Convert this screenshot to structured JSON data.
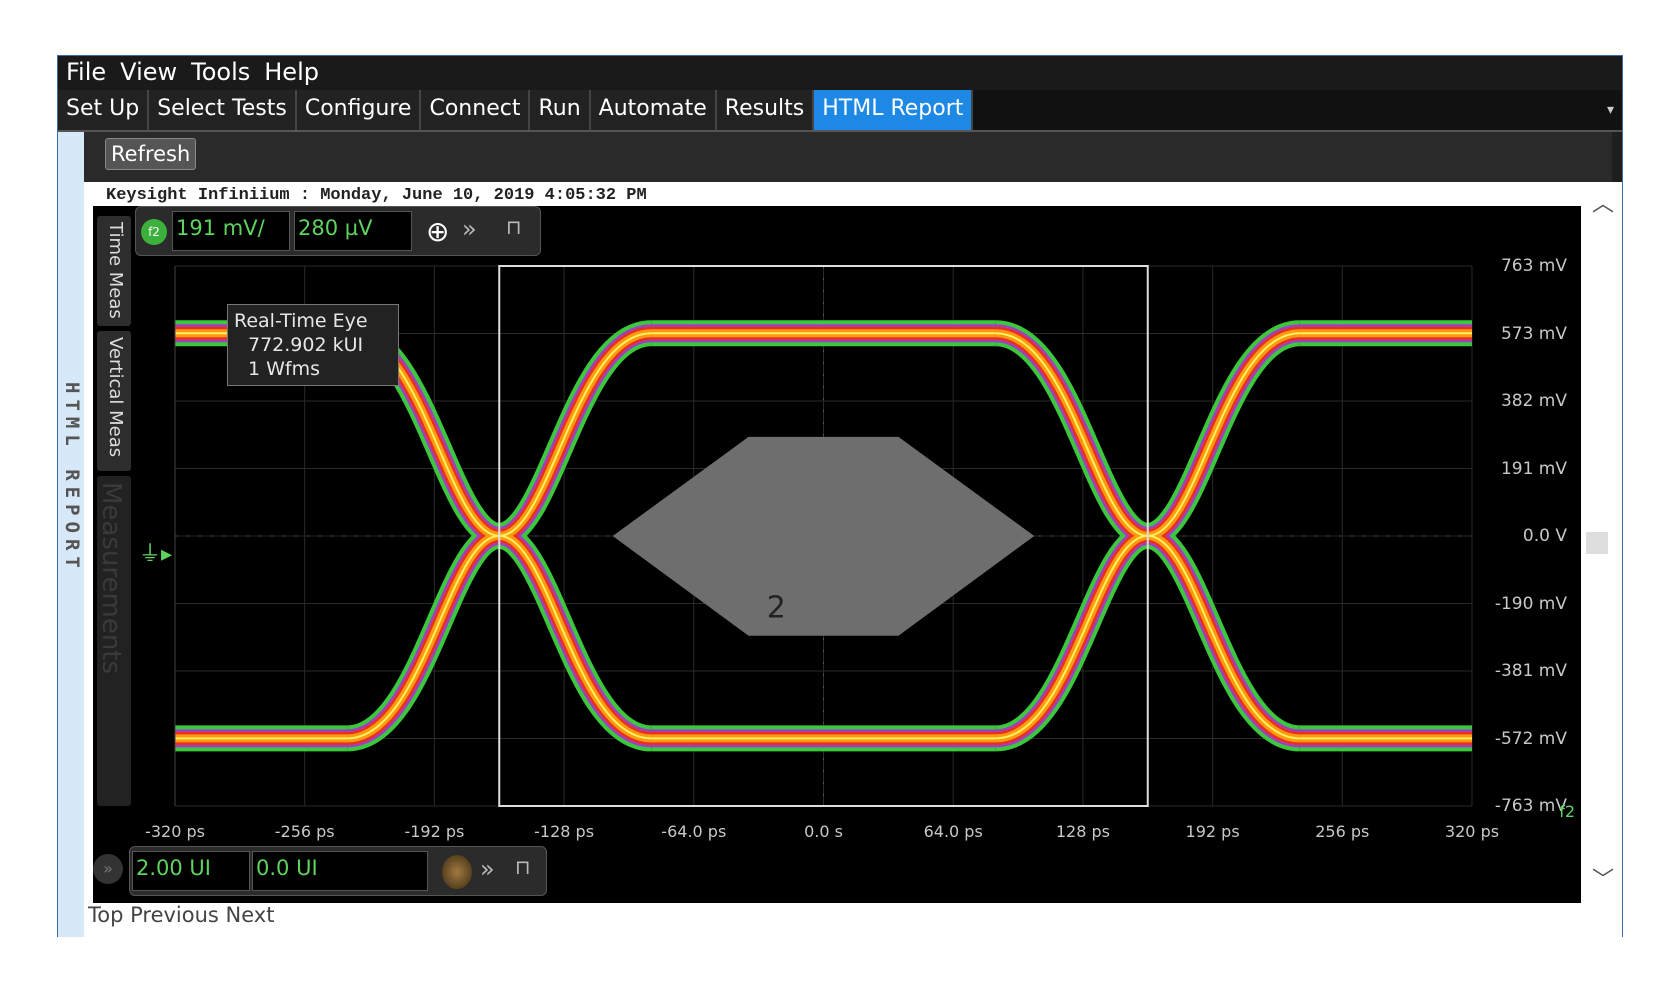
{
  "menu": [
    "File",
    "View",
    "Tools",
    "Help"
  ],
  "tabs": [
    "Set Up",
    "Select Tests",
    "Configure",
    "Connect",
    "Run",
    "Automate",
    "Results",
    "HTML Report"
  ],
  "active_tab": "HTML Report",
  "side_label": "HTML REPORT",
  "refresh_label": "Refresh",
  "report_header": "Keysight Infiniium : Monday, June 10, 2019 4:05:32 PM",
  "scope": {
    "channel": "f2",
    "vscale": "191 mV/",
    "voffset": "280 µV",
    "side_tabs": [
      "Time Meas",
      "Vertical Meas",
      "Measurements"
    ],
    "tooltip": [
      "Real-Time Eye",
      "772.902 kUI",
      "1 Wfms"
    ],
    "h_scale": "2.00 UI",
    "h_position": "0.0 UI",
    "mask_label": "2",
    "channel_tag": "f2"
  },
  "chart_data": {
    "type": "line",
    "title": "",
    "x_ticks": [
      "-320 ps",
      "-256 ps",
      "-192 ps",
      "-128 ps",
      "-64.0 ps",
      "0.0 s",
      "64.0 ps",
      "128 ps",
      "192 ps",
      "256 ps",
      "320 ps"
    ],
    "y_ticks": [
      "763 mV",
      "573 mV",
      "382 mV",
      "191 mV",
      "0.0 V",
      "-190 mV",
      "-381 mV",
      "-572 mV",
      "-763 mV"
    ],
    "xlim": [
      -320,
      320
    ],
    "ylim": [
      -763,
      763
    ],
    "grid": true,
    "eye": {
      "high_mV": 573,
      "low_mV": -572,
      "crossings_ps": [
        -160,
        160
      ],
      "window_ps": [
        -160,
        160
      ]
    },
    "mask_polygon_ps_mV": [
      [
        -104,
        0
      ],
      [
        -37,
        280
      ],
      [
        37,
        280
      ],
      [
        104,
        0
      ],
      [
        37,
        -282
      ],
      [
        -37,
        -282
      ]
    ],
    "colors": {
      "outer": "#3cc83c",
      "mid": "#a040c0",
      "inner": "#e83020",
      "core": "#ff9a10",
      "peak": "#fff060",
      "mask": "#6e6e6e"
    }
  },
  "footer_nav": "Top Previous Next"
}
